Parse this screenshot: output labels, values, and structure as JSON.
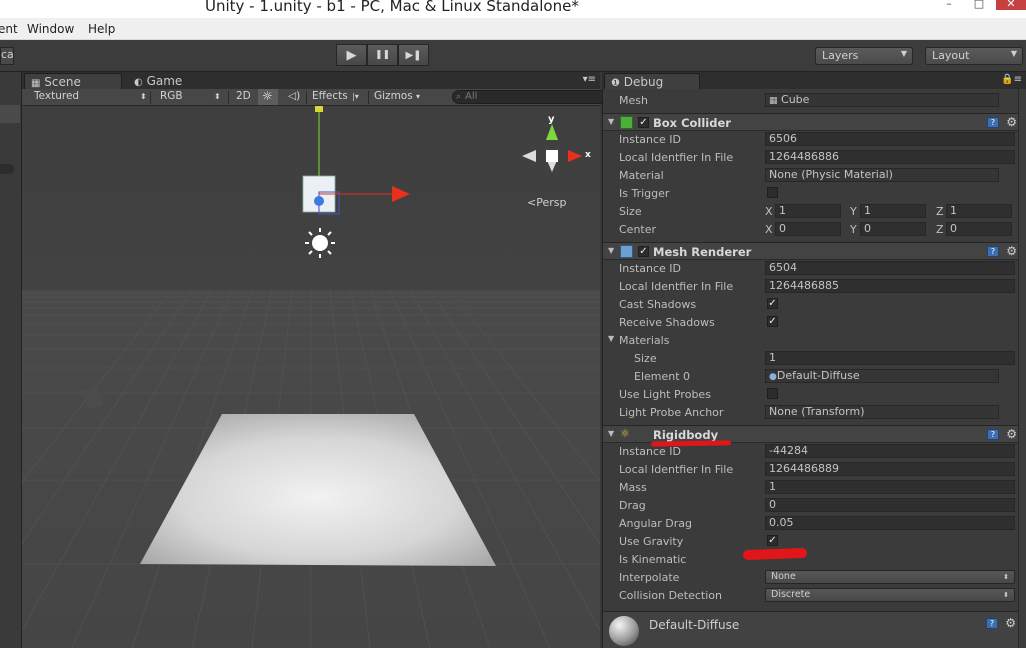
{
  "window": {
    "title": "Unity - 1.unity - b1 - PC, Mac & Linux Standalone*",
    "min": "–",
    "max": "□",
    "close": "✕"
  },
  "menu": {
    "items": [
      "ent",
      "Window",
      "Help"
    ]
  },
  "toolbar": {
    "local": "cal",
    "play": "▶",
    "pause": "❚❚",
    "step": "▶❚",
    "layers": "Layers",
    "layout": "Layout"
  },
  "scene": {
    "tab_scene": "Scene",
    "tab_game": "Game",
    "shading": "Textured",
    "render": "RGB",
    "mode_2d": "2D",
    "effects": "Effects",
    "gizmos": "Gizmos",
    "search_placeholder": "All",
    "persp": "Persp",
    "gizmo_y": "y",
    "gizmo_x": "x"
  },
  "inspector": {
    "tab": "Debug",
    "mesh_label": "Mesh",
    "mesh_value": "Cube",
    "box_collider": {
      "name": "Box Collider",
      "instance_id_label": "Instance ID",
      "instance_id": "6506",
      "local_id_label": "Local Identfier In File",
      "local_id": "1264486886",
      "material_label": "Material",
      "material": "None (Physic Material)",
      "is_trigger_label": "Is Trigger",
      "size_label": "Size",
      "size": [
        "1",
        "1",
        "1"
      ],
      "center_label": "Center",
      "center": [
        "0",
        "0",
        "0"
      ]
    },
    "mesh_renderer": {
      "name": "Mesh Renderer",
      "instance_id_label": "Instance ID",
      "instance_id": "6504",
      "local_id_label": "Local Identfier In File",
      "local_id": "1264486885",
      "cast_shadows_label": "Cast Shadows",
      "receive_shadows_label": "Receive Shadows",
      "materials_label": "Materials",
      "size_label": "Size",
      "size": "1",
      "element0_label": "Element 0",
      "element0": "Default-Diffuse",
      "light_probes_label": "Use Light Probes",
      "anchor_label": "Light Probe Anchor",
      "anchor": "None (Transform)"
    },
    "rigidbody": {
      "name": "Rigidbody",
      "instance_id_label": "Instance ID",
      "instance_id": "-44284",
      "local_id_label": "Local Identfier In File",
      "local_id": "1264486889",
      "mass_label": "Mass",
      "mass": "1",
      "drag_label": "Drag",
      "drag": "0",
      "angular_drag_label": "Angular Drag",
      "angular_drag": "0.05",
      "use_gravity_label": "Use Gravity",
      "is_kinematic_label": "Is Kinematic",
      "interpolate_label": "Interpolate",
      "interpolate": "None",
      "collision_label": "Collision Detection",
      "collision": "Discrete"
    },
    "material_name": "Default-Diffuse"
  },
  "axis_labels": [
    "X",
    "Y",
    "Z"
  ],
  "check_mark": "✓",
  "colors": {
    "annotation_red": "#e0161b",
    "gizmo_green": "#7fd83a",
    "gizmo_red": "#e8301c"
  }
}
